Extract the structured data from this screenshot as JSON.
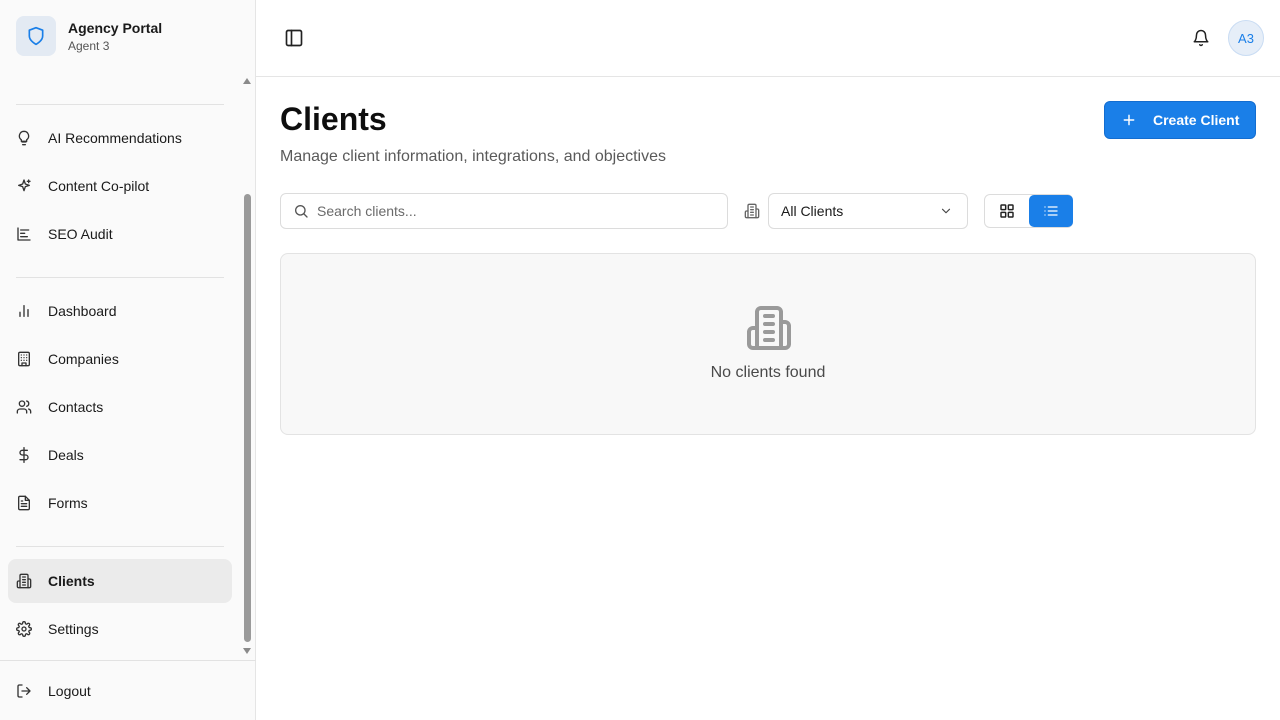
{
  "brand": {
    "title": "Agency Portal",
    "subtitle": "Agent 3"
  },
  "sidebar": {
    "groups": [
      {
        "items": [
          {
            "label": "AI Recommendations",
            "icon": "lightbulb-icon"
          },
          {
            "label": "Content Co-pilot",
            "icon": "sparkles-icon"
          },
          {
            "label": "SEO Audit",
            "icon": "chart-line-icon"
          }
        ]
      },
      {
        "items": [
          {
            "label": "Dashboard",
            "icon": "bar-chart-icon"
          },
          {
            "label": "Companies",
            "icon": "building-icon"
          },
          {
            "label": "Contacts",
            "icon": "users-icon"
          },
          {
            "label": "Deals",
            "icon": "dollar-icon"
          },
          {
            "label": "Forms",
            "icon": "file-text-icon"
          }
        ]
      },
      {
        "items": [
          {
            "label": "Clients",
            "icon": "building-icon",
            "active": true
          },
          {
            "label": "Settings",
            "icon": "gear-icon"
          }
        ]
      }
    ],
    "logout_label": "Logout"
  },
  "header": {
    "avatar_initials": "A3"
  },
  "main": {
    "title": "Clients",
    "subtitle": "Manage client information, integrations, and objectives",
    "create_label": "Create Client",
    "search_placeholder": "Search clients...",
    "filter_value": "All Clients",
    "view_mode": "list",
    "empty_text": "No clients found"
  },
  "colors": {
    "accent": "#1a7fe8",
    "active_bg": "#ebebeb"
  }
}
